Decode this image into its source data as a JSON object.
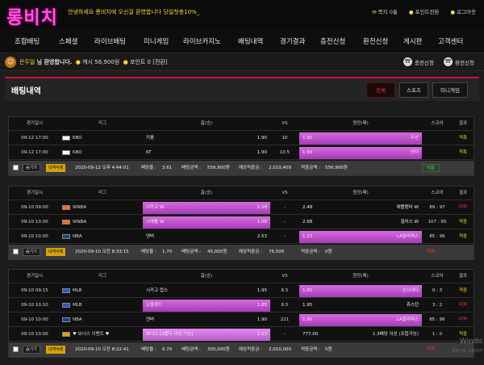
{
  "header": {
    "logo": "롱비치",
    "marquee": "안녕하세요 롱비치에 오신걸 환영합니다 당일첫충10%_",
    "links": [
      {
        "label": "쪽지 0통"
      },
      {
        "label": "포인트전환"
      },
      {
        "label": "로그아웃"
      }
    ]
  },
  "nav": [
    "조합배팅",
    "스페셜",
    "라이브배팅",
    "미니게임",
    "라이브카지노",
    "배팅내역",
    "경기결과",
    "충전신청",
    "환전신청",
    "게시판",
    "고객센터"
  ],
  "user": {
    "name": "은두일",
    "welcome": "님 환영합니다.",
    "cash_label": "캐시",
    "cash": "56,900원",
    "point_label": "포인트",
    "point": "0 [전환]",
    "charge": "충전신청",
    "exchange": "환전신청"
  },
  "section": {
    "title": "배팅내역",
    "tabs": [
      "전체",
      "스포츠",
      "미니게임"
    ]
  },
  "columns": [
    "경기일시",
    "리그",
    "홈(승)",
    "VS",
    "원정(패)",
    "스코어",
    "결과"
  ],
  "footer_labels": {
    "hide": "숨기기",
    "delete": "내역삭제",
    "odds": "배당율 :",
    "bet": "배팅금액 :",
    "expected": "예상적중금 :",
    "hit": "적중금액 :"
  },
  "bets": [
    {
      "rows": [
        {
          "time": "09-12 17:00",
          "league": "KBO",
          "flag": "kbo",
          "home": "키움",
          "home_odd": "1.90",
          "vs": "10",
          "away": "두산",
          "away_odd": "1.90",
          "pick": "away",
          "score": "",
          "result": "적특",
          "result_class": "win"
        },
        {
          "time": "09-12 17:00",
          "league": "KBO",
          "flag": "kbo",
          "home": "KT",
          "home_odd": "1.90",
          "vs": "10.5",
          "away": "언더",
          "away_odd": "1.90",
          "pick": "away",
          "score": "",
          "result": "적특",
          "result_class": "win"
        }
      ],
      "footer": {
        "datetime": "2020-09-12 오후 4:44:01",
        "odds": "3.61",
        "bet": "556,900원",
        "expected": "2,010,409",
        "hit": "556,900원",
        "result": "적특",
        "result_class": "win"
      }
    },
    {
      "rows": [
        {
          "time": "09-10 09:00",
          "league": "WNBA",
          "flag": "wnba",
          "home": "시카고 W",
          "home_odd": "1.28",
          "vs": "-",
          "away": "애틀랜타 W",
          "away_odd": "2.48",
          "pick": "home",
          "score": "89 : 97",
          "result": "미적",
          "result_class": "lose"
        },
        {
          "time": "09-10 10:00",
          "league": "WNBA",
          "flag": "wnba",
          "home": "시애틀 W",
          "home_odd": "1.08",
          "vs": "-",
          "away": "댈러스 W",
          "away_odd": "2.68",
          "pick": "home",
          "score": "107 : 95",
          "result": "적중",
          "result_class": "win"
        },
        {
          "time": "09-10 10:00",
          "league": "NBA",
          "flag": "nba",
          "home": "덴버",
          "home_odd": "2.53",
          "vs": "-",
          "away": "LA클리퍼스",
          "away_odd": "1.23",
          "pick": "away",
          "score": "85 : 96",
          "result": "적중",
          "result_class": "win"
        }
      ],
      "footer": {
        "datetime": "2020-09-10 오전 8:33:15",
        "odds": "1.70",
        "bet": "45,000원",
        "expected": "76,500",
        "hit": "0원",
        "result": "미적",
        "result_class": "lose"
      }
    },
    {
      "rows": [
        {
          "time": "09-10 09:15",
          "league": "MLB",
          "flag": "mlb",
          "home": "시카고 컵스",
          "home_odd": "1.95",
          "vs": "6.5",
          "away": "신시내티",
          "away_odd": "1.85",
          "pick": "away",
          "score": "0 : 3",
          "result": "적중",
          "result_class": "win"
        },
        {
          "time": "09-10 10:10",
          "league": "MLB",
          "flag": "mlb",
          "home": "오클랜드",
          "home_odd": "1.85",
          "vs": "8.5",
          "away": "휴스턴",
          "away_odd": "1.95",
          "pick": "home",
          "score": "3 : 2",
          "result": "미적",
          "result_class": "lose"
        },
        {
          "time": "09-10 10:00",
          "league": "NBA",
          "flag": "nba",
          "home": "덴버",
          "home_odd": "1.90",
          "vs": "221",
          "away": "LA클리퍼스",
          "away_odd": "1.90",
          "pick": "away",
          "score": "85 : 96",
          "result": "미적",
          "result_class": "lose"
        },
        {
          "time": "09-10 10:00",
          "league": "♥ 보너스 이벤트 ♥",
          "flag": "bonus",
          "home": "보너스 [3폴더 이상 가능]",
          "home_odd": "1.03",
          "vs": "-",
          "away": "1.3배당 이상 (조합가능)",
          "away_odd": "777.00",
          "pick": "home",
          "score": "1 : 0",
          "result": "적중",
          "result_class": "win"
        }
      ],
      "footer": {
        "datetime": "2020-09-10 오전 8:22:41",
        "odds": "6.70",
        "bet": "300,000원",
        "expected": "2,010,000",
        "hit": "0원",
        "result": "미적",
        "result_class": "lose"
      }
    }
  ],
  "watermark": "Windo",
  "watermark_sub": "설정으로 이동하여"
}
